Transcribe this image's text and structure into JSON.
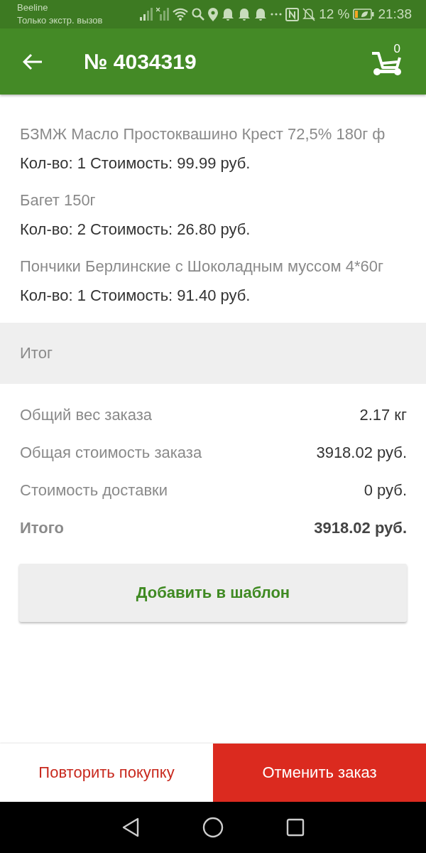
{
  "status_bar": {
    "carrier": "Beeline",
    "carrier_note": "Только экстр. вызов",
    "battery_text": "12 %",
    "time": "21:38"
  },
  "header": {
    "title": "№ 4034319",
    "cart_count": "0"
  },
  "items": [
    {
      "name": "БЗМЖ Масло Простоквашино Крест 72,5% 180г ф",
      "details": "Кол-во: 1 Стоимость: 99.99 руб."
    },
    {
      "name": "Багет 150г",
      "details": "Кол-во: 2 Стоимость: 26.80 руб."
    },
    {
      "name": "Пончики Берлинские с Шоколадным муссом 4*60г",
      "details": "Кол-во: 1 Стоимость: 91.40 руб."
    }
  ],
  "summary_heading": "Итог",
  "summary": [
    {
      "label": "Общий вес заказа",
      "value": "2.17 кг",
      "kind": "plain"
    },
    {
      "label": "Общая стоимость заказа",
      "value": "3918.02 руб.",
      "kind": "plain"
    },
    {
      "label": "Стоимость доставки",
      "value": "0 руб.",
      "kind": "plain"
    },
    {
      "label": "Итого",
      "value": "3918.02 руб.",
      "kind": "total"
    }
  ],
  "template_button": "Добавить в шаблон",
  "actions": [
    {
      "label": "Повторить покупку",
      "kind": "secondary"
    },
    {
      "label": "Отменить заказ",
      "kind": "primary"
    }
  ]
}
